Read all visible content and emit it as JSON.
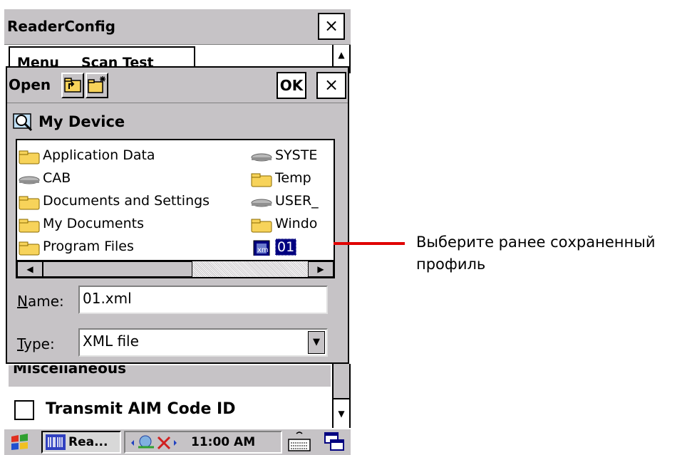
{
  "window": {
    "title": "ReaderConfig",
    "close_label": "×"
  },
  "menubar": {
    "items": [
      "Menu",
      "Scan Test"
    ]
  },
  "dialog": {
    "title": "Open",
    "ok_label": "OK",
    "close_label": "×",
    "location": "My Device",
    "files": [
      {
        "name": "Application Data",
        "kind": "folder"
      },
      {
        "name": "CAB",
        "kind": "drive"
      },
      {
        "name": "Documents and Settings",
        "kind": "folder"
      },
      {
        "name": "My Documents",
        "kind": "folder"
      },
      {
        "name": "Program Files",
        "kind": "folder"
      },
      {
        "name": "SYSTE",
        "kind": "drive"
      },
      {
        "name": "Temp",
        "kind": "folder"
      },
      {
        "name": "USER_",
        "kind": "drive"
      },
      {
        "name": "Windo",
        "kind": "folder"
      },
      {
        "name": "01",
        "kind": "xml-file",
        "selected": true
      }
    ],
    "name_label_underlined": "N",
    "name_label_rest": "ame:",
    "name_value": "01.xml",
    "type_label_underlined": "T",
    "type_label_rest": "ype:",
    "type_value": "XML file"
  },
  "background": {
    "section": "Miscellaneous",
    "checkbox_label": "Transmit AIM Code ID",
    "checkbox_checked": false
  },
  "taskbar": {
    "app_label": "Rea...",
    "time": "11:00 AM"
  },
  "annotation": {
    "text": "Выберите ранее сохраненный профиль",
    "line_color": "#e00000"
  },
  "colors": {
    "chrome": "#c6c3c6",
    "selection": "#000080",
    "folder": "#f7d35a"
  }
}
